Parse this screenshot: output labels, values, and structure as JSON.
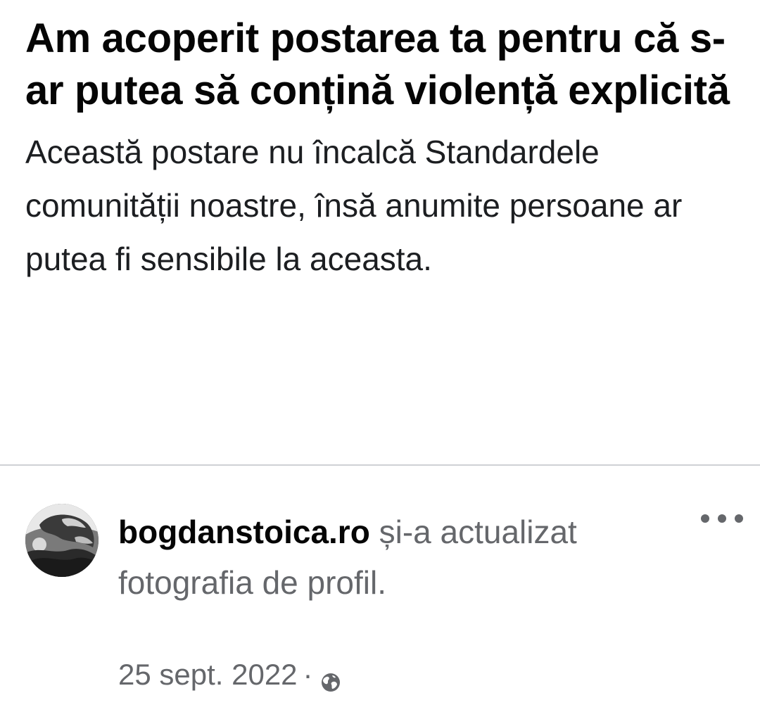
{
  "warning": {
    "title": "Am acoperit postarea ta pentru că s-ar putea să conțină violență explicită",
    "description": "Această postare nu încalcă Standardele comunității noastre, însă anumite persoane ar putea fi sensibile la aceasta."
  },
  "post": {
    "author": "bogdanstoica.ro",
    "action": "și-a actualizat fotografia de profil.",
    "date": "25 sept. 2022",
    "separator": "·",
    "audience_icon": "globe-icon",
    "more_icon": "more-options-icon"
  },
  "colors": {
    "primary_text": "#050505",
    "secondary_text": "#65676b",
    "divider": "#cfd1d5"
  }
}
